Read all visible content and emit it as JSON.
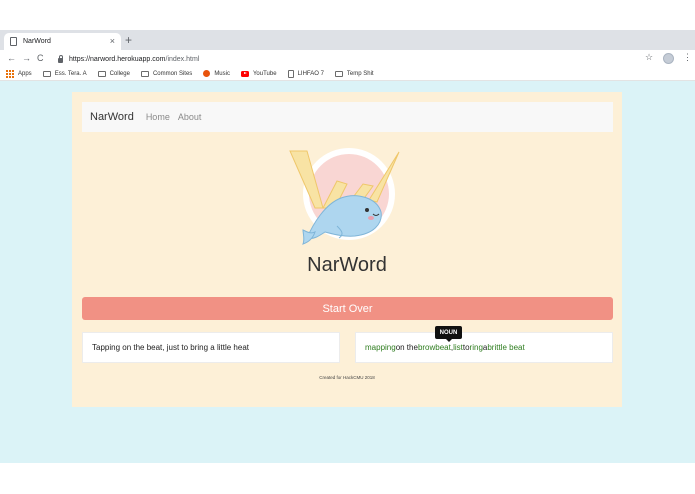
{
  "browser": {
    "tab_title": "NarWord",
    "tab_close": "×",
    "new_tab": "+",
    "nav": {
      "back": "←",
      "forward": "→",
      "reload": "C"
    },
    "url_domain": "https://narword.herokuapp.com",
    "url_path": "/index.html",
    "star": "☆",
    "menu": "⋮",
    "bookmarks": [
      {
        "label": "Apps",
        "icon": "apps-grid-icon"
      },
      {
        "label": "Ess. Tera. A",
        "icon": "folder-icon"
      },
      {
        "label": "College",
        "icon": "folder-icon"
      },
      {
        "label": "Common Sites",
        "icon": "folder-icon"
      },
      {
        "label": "Music",
        "icon": "music-icon"
      },
      {
        "label": "YouTube",
        "icon": "youtube-icon"
      },
      {
        "label": "LIHFAO 7",
        "icon": "page-icon"
      },
      {
        "label": "Temp Shit",
        "icon": "folder-icon"
      }
    ]
  },
  "navbar": {
    "brand": "NarWord",
    "links": [
      "Home",
      "About"
    ]
  },
  "main": {
    "heading": "NarWord",
    "start_button": "Start Over",
    "left_sentence": "Tapping on the beat, just to bring a little heat",
    "right_sentence": {
      "w1": "mapping",
      "t1": " on the ",
      "w2": "browbeat",
      "t2": ", ",
      "w3": "list",
      "t3": " to ",
      "w4": "ring",
      "t4": " a ",
      "w5": "brittle beat"
    },
    "tooltip": "NOUN",
    "footer": "Created for HackCMU 2018"
  },
  "colors": {
    "page_bg": "#dbf3f7",
    "card_bg": "#fdf0d7",
    "button": "#f19184",
    "word_green": "#2e7d1f"
  }
}
